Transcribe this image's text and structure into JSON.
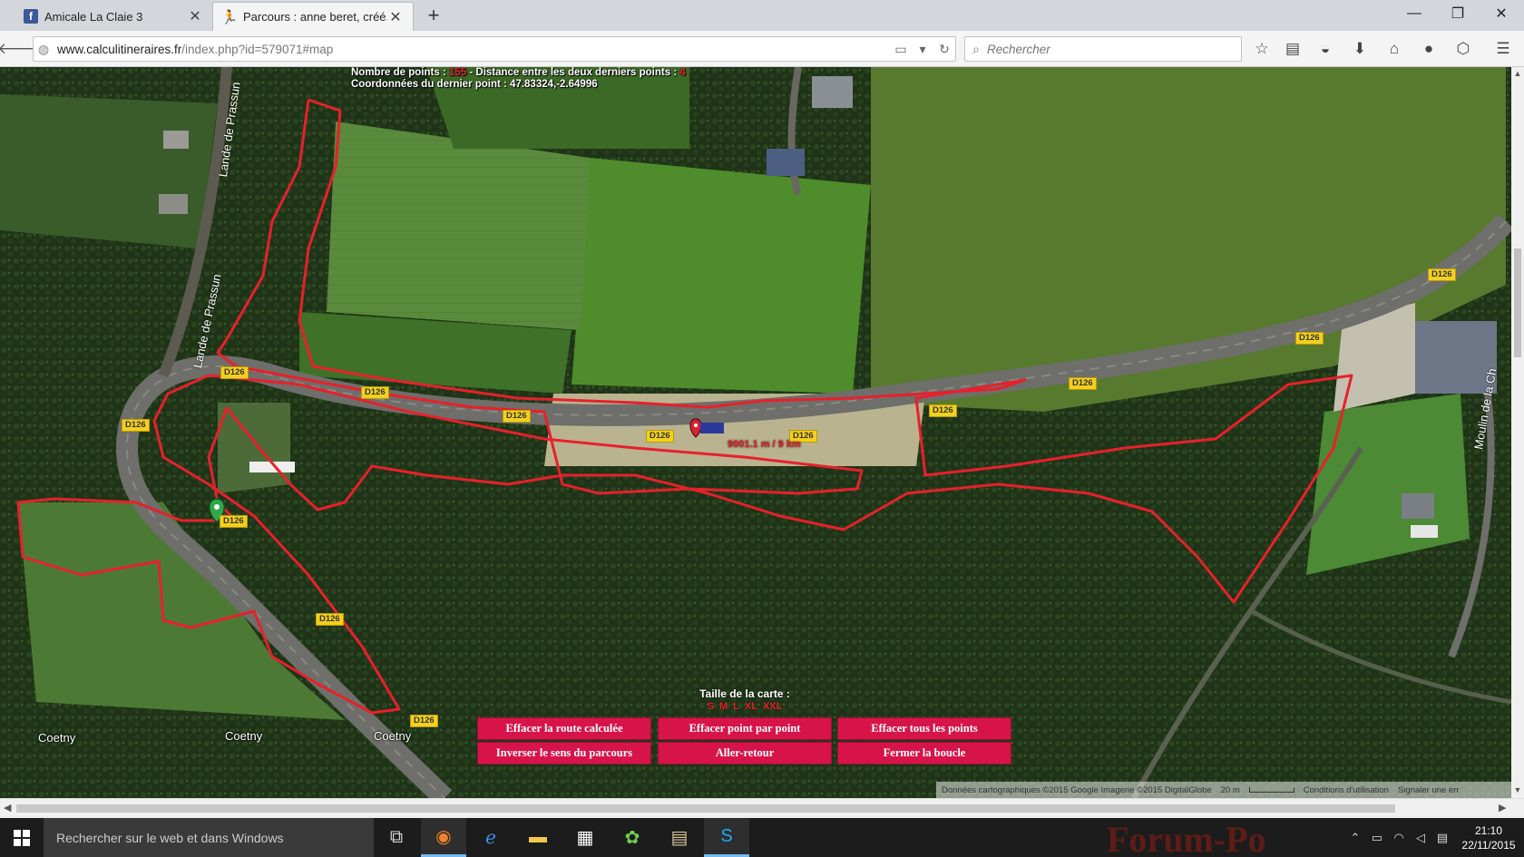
{
  "browser": {
    "tabs": [
      {
        "title": "Amicale La Claie 3",
        "favicon": "facebook-icon",
        "active": false
      },
      {
        "title": "Parcours : anne beret, créé...",
        "favicon": "runner-icon",
        "active": true
      }
    ],
    "new_tab_label": "+",
    "window_controls": {
      "minimize": "—",
      "maximize": "❐",
      "close": "✕"
    },
    "url_domain": "www.calculitineraires.fr",
    "url_path": "/index.php?id=579071#map",
    "search_placeholder": "Rechercher"
  },
  "map": {
    "info_line1_a": "Nombre de points : ",
    "info_points": "155",
    "info_line1_b": " - Distance entre les deux derniers points : ",
    "info_last_distance": "4",
    "info_line2": "Coordonnées du dernier point : 47.83324,-2.64996",
    "street_names": [
      "Lande de Prassun",
      "Lande de Prassun",
      "Moulin de la Ch"
    ],
    "road_label": "D126",
    "distance_label": "9001.1 m / 9 km",
    "place_names": [
      "Coetny",
      "Coetny",
      "Coetny"
    ],
    "size_title": "Taille de la carte :",
    "size_options": [
      "S",
      "M",
      "L",
      "XL",
      "XXL"
    ],
    "buttons": {
      "clear_route": "Effacer la route calculée",
      "clear_point": "Effacer point par point",
      "clear_all": "Effacer tous les points",
      "reverse": "Inverser le sens du parcours",
      "round_trip": "Aller-retour",
      "close_loop": "Fermer la boucle"
    },
    "attribution": {
      "data": "Données cartographiques ©2015 Google Imagerie ©2015 DigitalGlobe",
      "scale": "20 m",
      "terms": "Conditions d'utilisation",
      "report": "Signaler une err"
    },
    "colors": {
      "route": "#e8202c",
      "button": "#d6144a",
      "road_label_bg": "#f3d01c"
    }
  },
  "taskbar": {
    "search_placeholder": "Rechercher sur le web et dans Windows",
    "watermark": "Forum-Po",
    "time": "21:10",
    "date": "22/11/2015"
  }
}
